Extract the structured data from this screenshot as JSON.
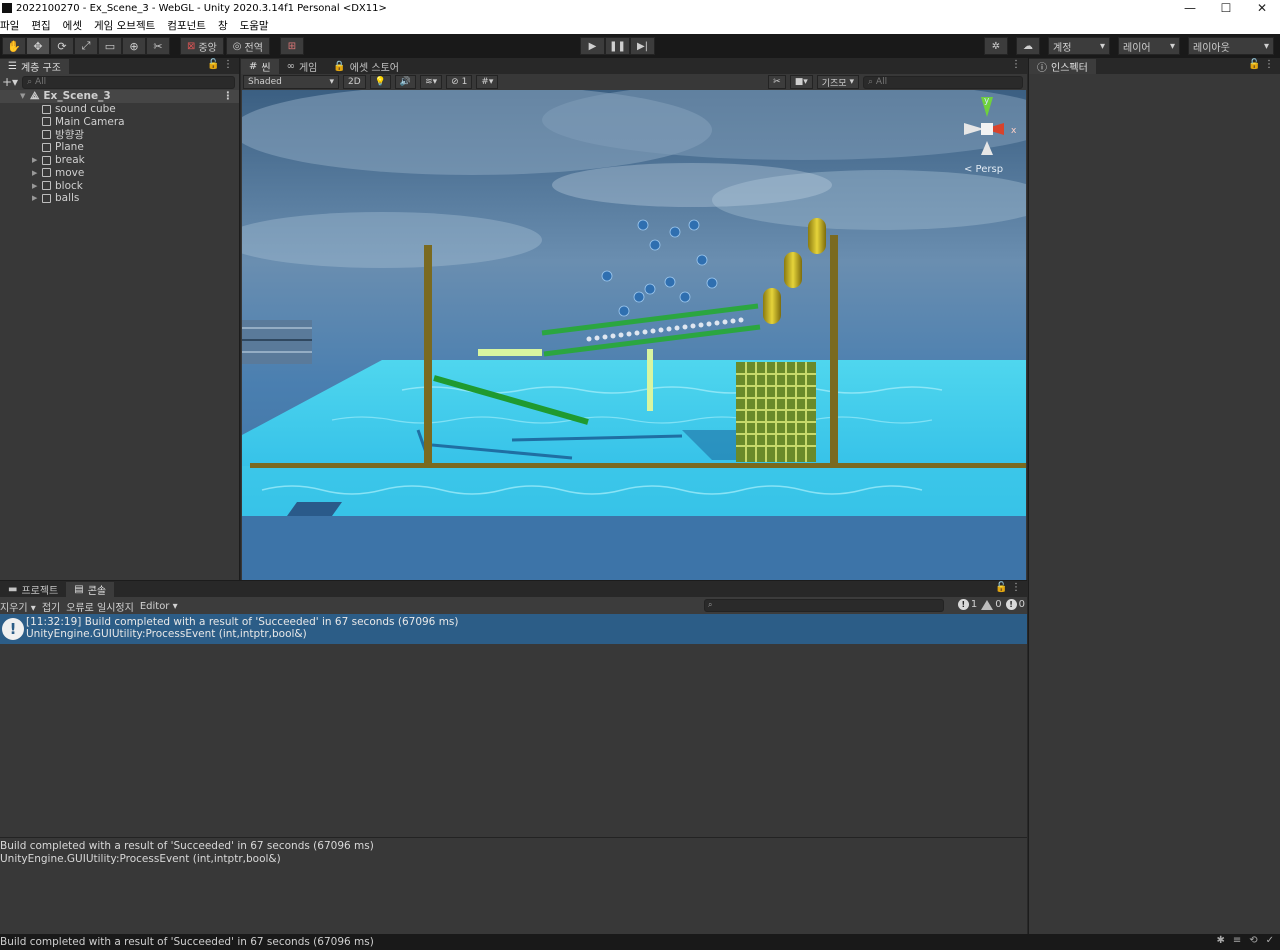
{
  "window": {
    "title": "2022100270 - Ex_Scene_3 - WebGL - Unity 2020.3.14f1 Personal <DX11>",
    "controls": [
      "—",
      "☐",
      "✕"
    ]
  },
  "menu": [
    "파일",
    "편집",
    "에셋",
    "게임 오브젝트",
    "컴포넌트",
    "창",
    "도움말"
  ],
  "toolbar": {
    "pivot_label": "중앙",
    "space_label": "전역",
    "account_label": "계정",
    "layers_label": "레이어",
    "layout_label": "레이아웃"
  },
  "hierarchy": {
    "tab_label": "계층 구조",
    "search_placeholder": "All",
    "scene_name": "Ex_Scene_3",
    "items": [
      {
        "label": "sound cube",
        "expandable": false
      },
      {
        "label": "Main Camera",
        "expandable": false
      },
      {
        "label": "방향광",
        "expandable": false
      },
      {
        "label": "Plane",
        "expandable": false
      },
      {
        "label": "break",
        "expandable": true
      },
      {
        "label": "move",
        "expandable": true
      },
      {
        "label": "block",
        "expandable": true
      },
      {
        "label": "balls",
        "expandable": true
      }
    ]
  },
  "scene": {
    "tabs": [
      {
        "label": "씬",
        "icon": "grid-icon"
      },
      {
        "label": "게임",
        "icon": "gamepad-icon"
      },
      {
        "label": "에셋 스토어",
        "icon": "store-icon"
      }
    ],
    "shading_mode": "Shaded",
    "mode_2d": "2D",
    "hidden_count": "1",
    "gizmos_label": "기즈모",
    "search_placeholder": "All",
    "persp_label": "< Persp",
    "axis_y": "y",
    "axis_x": "x"
  },
  "inspector": {
    "tab_label": "인스펙터"
  },
  "console": {
    "tabs": [
      {
        "label": "프로젝트",
        "icon": "folder-icon"
      },
      {
        "label": "콘솔",
        "icon": "console-icon"
      }
    ],
    "clear_label": "지우기",
    "collapse_label": "접기",
    "error_pause_label": "오류로 일시정지",
    "editor_label": "Editor",
    "info_count": "1",
    "warning_count": "0",
    "error_count": "0",
    "entry_line1": "[11:32:19] Build completed with a result of 'Succeeded' in 67 seconds (67096 ms)",
    "entry_line2": "UnityEngine.GUIUtility:ProcessEvent (int,intptr,bool&)",
    "detail_line1": "Build completed with a result of 'Succeeded' in 67 seconds (67096 ms)",
    "detail_line2": "UnityEngine.GUIUtility:ProcessEvent (int,intptr,bool&)"
  },
  "status": {
    "message": "Build completed with a result of 'Succeeded' in 67 seconds (67096 ms)"
  }
}
